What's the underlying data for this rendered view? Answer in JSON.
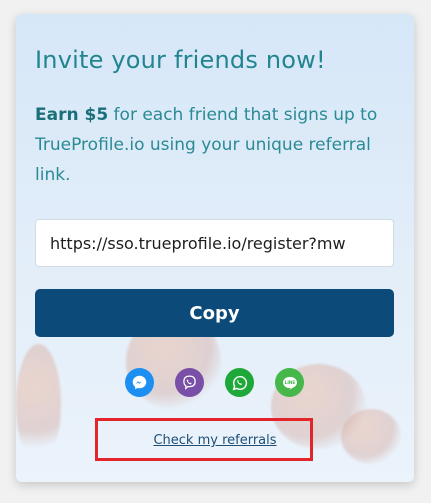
{
  "invite": {
    "title": "Invite your friends now!",
    "desc_strong": "Earn $5",
    "desc_rest": " for each friend that signs up to TrueProfile.io using your unique referral link.",
    "referral_link": "https://sso.trueprofile.io/register?mw",
    "copy_label": "Copy",
    "referrals_link_label": "Check my referrals"
  },
  "share": {
    "icons": [
      "messenger-icon",
      "viber-icon",
      "whatsapp-icon",
      "line-icon"
    ]
  },
  "colors": {
    "title": "#21858f",
    "copy_button": "#0b4a79",
    "highlight": "#e3242b"
  }
}
